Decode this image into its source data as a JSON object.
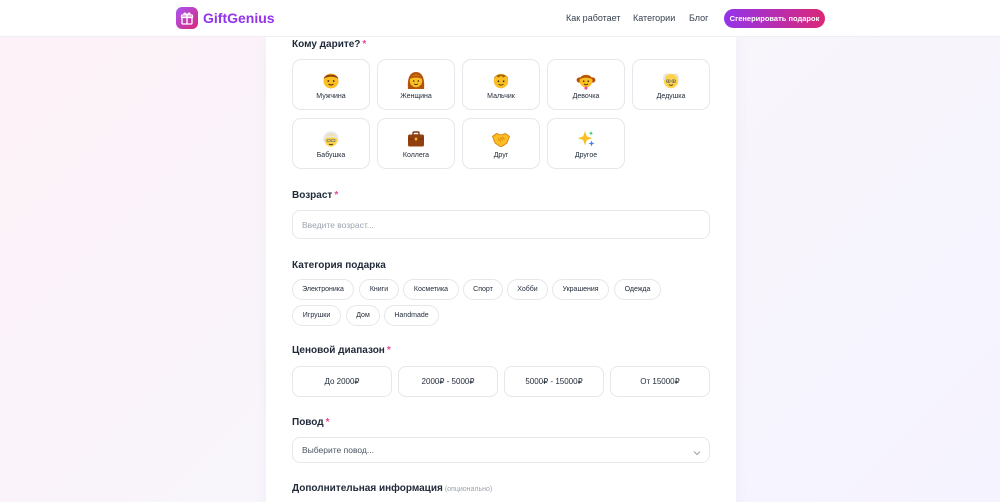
{
  "header": {
    "logo_text": "GiftGenius",
    "nav": [
      "Как работает",
      "Категории",
      "Блог"
    ],
    "cta_label": "Сгенерировать подарок",
    "brand_color": "#9333ea"
  },
  "form": {
    "recipient": {
      "label": "Кому дарите?",
      "required_mark": "*",
      "options": [
        {
          "label": "Мужчина",
          "icon": "man-emoji-icon"
        },
        {
          "label": "Женщина",
          "icon": "woman-emoji-icon"
        },
        {
          "label": "Мальчик",
          "icon": "boy-emoji-icon"
        },
        {
          "label": "Девочка",
          "icon": "girl-emoji-icon"
        },
        {
          "label": "Дедушка",
          "icon": "old-man-emoji-icon"
        },
        {
          "label": "Бабушка",
          "icon": "old-woman-emoji-icon"
        },
        {
          "label": "Коллега",
          "icon": "briefcase-emoji-icon"
        },
        {
          "label": "Друг",
          "icon": "handshake-emoji-icon"
        },
        {
          "label": "Другое",
          "icon": "sparkles-emoji-icon"
        }
      ]
    },
    "age": {
      "label": "Возраст",
      "required_mark": "*",
      "placeholder": "Введите возраст..."
    },
    "category": {
      "label": "Категория подарка",
      "chips": [
        "Электроника",
        "Книги",
        "Косметика",
        "Спорт",
        "Хобби",
        "Украшения",
        "Одежда",
        "Игрушки",
        "Дом",
        "Handmade"
      ]
    },
    "price": {
      "label": "Ценовой диапазон",
      "required_mark": "*",
      "options": [
        "До 2000₽",
        "2000₽ - 5000₽",
        "5000₽ - 15000₽",
        "От 15000₽"
      ]
    },
    "occasion": {
      "label": "Повод",
      "required_mark": "*",
      "placeholder": "Выберите повод..."
    },
    "extra": {
      "label": "Дополнительная информация",
      "optional_note": "(опционально)"
    }
  }
}
